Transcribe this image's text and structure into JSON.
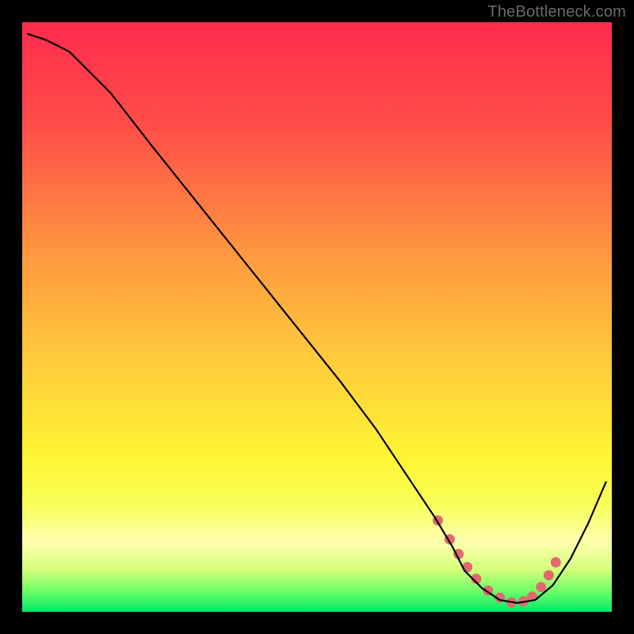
{
  "watermark": "TheBottleneck.com",
  "chart_data": {
    "type": "line",
    "title": "",
    "xlabel": "",
    "ylabel": "",
    "xlim": [
      0,
      100
    ],
    "ylim": [
      0,
      100
    ],
    "grid": false,
    "legend": false,
    "background_gradient": {
      "stops": [
        {
          "offset": 0.0,
          "color": "#ff2b4d"
        },
        {
          "offset": 0.18,
          "color": "#ff4f48"
        },
        {
          "offset": 0.4,
          "color": "#ff9a3f"
        },
        {
          "offset": 0.6,
          "color": "#ffd23a"
        },
        {
          "offset": 0.74,
          "color": "#fff633"
        },
        {
          "offset": 0.82,
          "color": "#f8ff5a"
        },
        {
          "offset": 0.88,
          "color": "#ffffb0"
        },
        {
          "offset": 0.93,
          "color": "#d2ff7a"
        },
        {
          "offset": 0.965,
          "color": "#6dff66"
        },
        {
          "offset": 1.0,
          "color": "#00e86a"
        }
      ]
    },
    "series": [
      {
        "name": "bottleneck-curve",
        "color": "#000000",
        "width": 2.2,
        "x": [
          1,
          4,
          8,
          15,
          22,
          30,
          38,
          46,
          54,
          60,
          66,
          70,
          73,
          75,
          78,
          81,
          84,
          87,
          90,
          93,
          96,
          99
        ],
        "values": [
          98,
          97,
          95,
          88,
          79,
          69,
          59,
          49,
          39,
          31,
          22,
          16,
          11,
          7,
          4,
          2,
          1.5,
          2,
          4.5,
          9,
          15,
          22
        ]
      }
    ],
    "highlight_segment": {
      "name": "optimal-range-dots",
      "color": "#e06a6e",
      "dot_radius": 6.5,
      "x": [
        70.5,
        72.5,
        74,
        75.5,
        77,
        79,
        81,
        83,
        85,
        86.5,
        88,
        89.3,
        90.5
      ],
      "values": [
        15.5,
        12.3,
        9.8,
        7.6,
        5.6,
        3.6,
        2.4,
        1.6,
        1.8,
        2.6,
        4.2,
        6.2,
        8.4
      ]
    }
  }
}
